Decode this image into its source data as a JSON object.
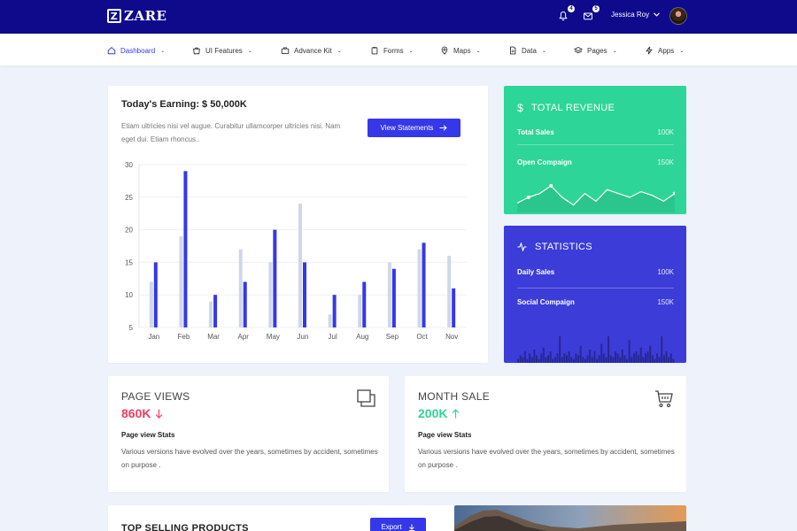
{
  "brand": {
    "logo_letter": "Z",
    "name": "ZARE"
  },
  "topbar": {
    "notification_count": "4",
    "message_count": "5",
    "user_name": "Jessica Roy"
  },
  "nav": {
    "items": [
      {
        "label": "Dashboard",
        "icon": "home-icon",
        "active": true
      },
      {
        "label": "UI Features",
        "icon": "bag-icon"
      },
      {
        "label": "Advance Kit",
        "icon": "briefcase-icon"
      },
      {
        "label": "Forms",
        "icon": "clipboard-icon"
      },
      {
        "label": "Maps",
        "icon": "map-pin-icon"
      },
      {
        "label": "Data",
        "icon": "document-icon"
      },
      {
        "label": "Pages",
        "icon": "layers-icon"
      },
      {
        "label": "Apps",
        "icon": "lightning-icon"
      }
    ]
  },
  "earnings": {
    "title": "Today's Earning: $ 50,000K",
    "description": "Etiam ultricies nisi vel augue. Curabitur ullamcorper ultricies nisi. Nam eget dui. Etiam rhoncus..",
    "button_label": "View Statements"
  },
  "chart_data": {
    "type": "bar",
    "categories": [
      "Jan",
      "Feb",
      "Mar",
      "Apr",
      "May",
      "Jun",
      "Jul",
      "Aug",
      "Sep",
      "Oct",
      "Nov"
    ],
    "series": [
      {
        "values": [
          12,
          19,
          9,
          17,
          15,
          24,
          7,
          10,
          15,
          17,
          16
        ],
        "color": "#cfd7e9"
      },
      {
        "values": [
          15,
          29,
          10,
          12,
          20,
          15,
          10,
          12,
          14,
          18,
          11
        ],
        "color": "#3538e8"
      }
    ],
    "yticks": [
      30,
      25,
      20,
      15,
      10,
      5
    ],
    "ylim": [
      5,
      30
    ],
    "grid": true
  },
  "revenue": {
    "title": "TOTAL REVENUE",
    "rows": [
      {
        "label": "Total Sales",
        "value": "100K"
      },
      {
        "label": "Open Compaign",
        "value": "150K"
      }
    ],
    "sparkline": [
      3,
      6,
      8,
      12,
      6,
      2,
      8,
      4,
      10,
      8,
      6,
      9,
      7,
      4,
      8
    ],
    "color": "#2ed598"
  },
  "statistics": {
    "title": "STATISTICS",
    "rows": [
      {
        "label": "Daily Sales",
        "value": "100K"
      },
      {
        "label": "Social Compaign",
        "value": "150K"
      }
    ],
    "bars": [
      2,
      4,
      3,
      6,
      2,
      5,
      3,
      7,
      4,
      2,
      5,
      8,
      3,
      4,
      6,
      2,
      3,
      5,
      14,
      3,
      5,
      4,
      6,
      3,
      2,
      5,
      4,
      9,
      3,
      2,
      4,
      7,
      3,
      6,
      2,
      4,
      10,
      5,
      3,
      14,
      4,
      3,
      6,
      5,
      3,
      7,
      4,
      2,
      12,
      3,
      5,
      6,
      4,
      8,
      3,
      5,
      6,
      9,
      4,
      2,
      5,
      3,
      14,
      4,
      6,
      3,
      5,
      2
    ],
    "color": "#3c3cd8"
  },
  "page_views": {
    "title": "PAGE VIEWS",
    "value": "860K",
    "trend": "down",
    "subtitle": "Page view Stats",
    "description": "Various versions have evolved over the years, sometimes by accident, sometimes on purpose .",
    "icon": "copy-icon",
    "color": "#f03d5f"
  },
  "month_sale": {
    "title": "MONTH SALE",
    "value": "200K",
    "trend": "up",
    "subtitle": "Page view Stats",
    "description": "Various versions have evolved over the years, sometimes by accident, sometimes on purpose .",
    "icon": "cart-icon",
    "color": "#2ed598"
  },
  "products": {
    "title": "TOP SELLING PRODUCTS",
    "button_label": "Export"
  }
}
